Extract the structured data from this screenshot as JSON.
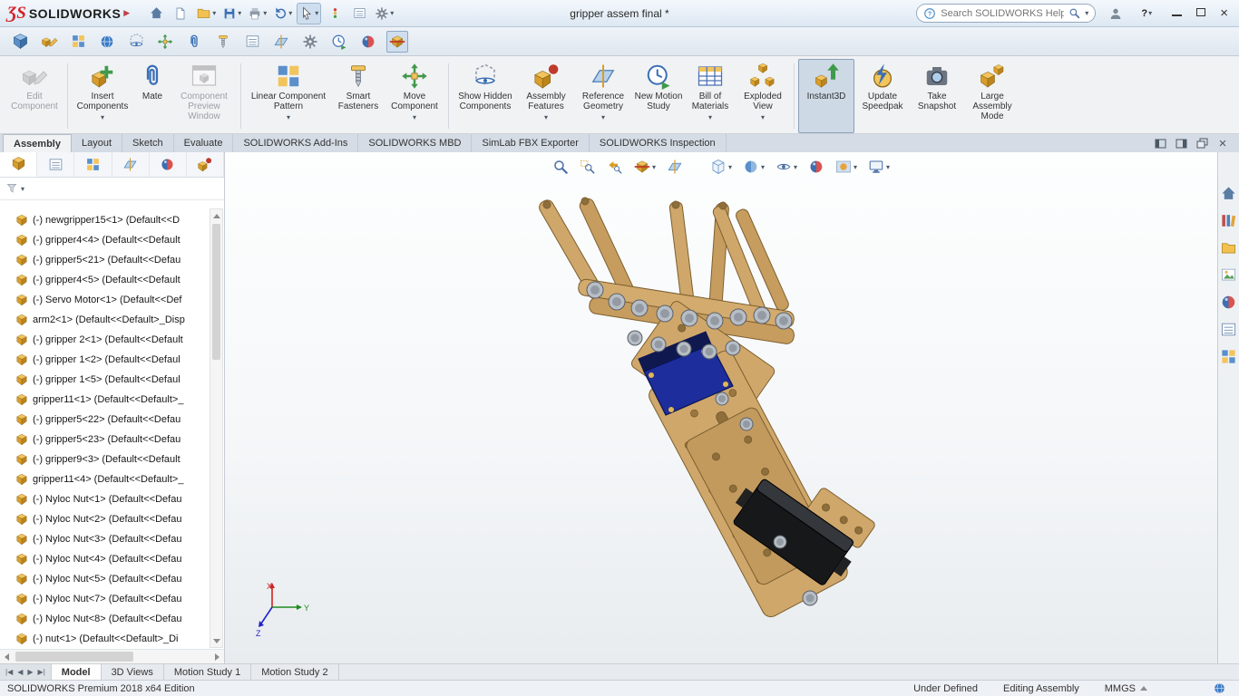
{
  "colors": {
    "brand_red": "#d42027",
    "accent_blue": "#3a6fb5",
    "part_tan": "#cfa76b",
    "servo_blue": "#1d2d9c",
    "active_highlight": "#cdd9e5"
  },
  "titlebar": {
    "brand_mark": "ƷS",
    "brand": "SOLIDWORKS",
    "menu_arrow": "▶",
    "doc_title": "gripper assem final *",
    "search_placeholder": "Search SOLIDWORKS Help",
    "help_label": "?",
    "icon_names": [
      "home-icon",
      "new-document-icon",
      "open-icon",
      "save-icon",
      "print-icon",
      "undo-icon",
      "select-cursor-icon",
      "stoplight-icon",
      "properties-list-icon",
      "options-gear-icon",
      "search-icon",
      "user-account-icon",
      "help-icon",
      "minimize-icon",
      "maximize-icon",
      "close-icon"
    ]
  },
  "quickbar": {
    "icon_names": [
      "view-cube-icon",
      "edit-part-icon",
      "pattern-grid-icon",
      "world-globe-icon",
      "hidden-component-icon",
      "move-component-icon",
      "mate-clip-icon",
      "fastener-screw-icon",
      "properties-list-icon",
      "reference-plane-icon",
      "options-gear-icon",
      "motion-clock-icon",
      "appearance-ball-icon",
      "section-view-icon"
    ]
  },
  "ribbon": {
    "buttons": [
      {
        "label": "Edit Component",
        "disabled": true,
        "dropdown": false
      },
      {
        "label": "Insert Components",
        "dropdown": true
      },
      {
        "label": "Mate",
        "dropdown": false
      },
      {
        "label": "Component Preview Window",
        "disabled": true,
        "dropdown": false
      },
      {
        "label": "Linear Component Pattern",
        "dropdown": true
      },
      {
        "label": "Smart Fasteners",
        "dropdown": false
      },
      {
        "label": "Move Component",
        "dropdown": true
      },
      {
        "label": "Show Hidden Components",
        "dropdown": false
      },
      {
        "label": "Assembly Features",
        "dropdown": true
      },
      {
        "label": "Reference Geometry",
        "dropdown": true
      },
      {
        "label": "New Motion Study",
        "dropdown": false
      },
      {
        "label": "Bill of Materials",
        "dropdown": true
      },
      {
        "label": "Exploded View",
        "dropdown": true
      },
      {
        "label": "Instant3D",
        "active": true,
        "dropdown": false
      },
      {
        "label": "Update Speedpak",
        "dropdown": false
      },
      {
        "label": "Take Snapshot",
        "dropdown": false
      },
      {
        "label": "Large Assembly Mode",
        "dropdown": false
      }
    ]
  },
  "command_tabs": [
    {
      "label": "Assembly",
      "active": true
    },
    {
      "label": "Layout"
    },
    {
      "label": "Sketch"
    },
    {
      "label": "Evaluate"
    },
    {
      "label": "SOLIDWORKS Add-Ins"
    },
    {
      "label": "SOLIDWORKS MBD"
    },
    {
      "label": "SimLab FBX Exporter"
    },
    {
      "label": "SOLIDWORKS Inspection"
    }
  ],
  "tree": {
    "items": [
      "(-) newgripper15<1> (Default<<D",
      "(-) gripper4<4> (Default<<Default",
      "(-) gripper5<21> (Default<<Defau",
      "(-) gripper4<5> (Default<<Default",
      "(-) Servo Motor<1> (Default<<Def",
      "arm2<1> (Default<<Default>_Disp",
      "(-) gripper 2<1> (Default<<Default",
      "(-) gripper 1<2> (Default<<Defaul",
      "(-) gripper 1<5> (Default<<Defaul",
      "gripper11<1> (Default<<Default>_",
      "(-) gripper5<22> (Default<<Defau",
      "(-) gripper5<23> (Default<<Defau",
      "(-) gripper9<3> (Default<<Default",
      "gripper11<4> (Default<<Default>_",
      "(-) Nyloc Nut<1> (Default<<Defau",
      "(-) Nyloc Nut<2> (Default<<Defau",
      "(-) Nyloc Nut<3> (Default<<Defau",
      "(-) Nyloc Nut<4> (Default<<Defau",
      "(-) Nyloc Nut<5> (Default<<Defau",
      "(-) Nyloc Nut<7> (Default<<Defau",
      "(-) Nyloc Nut<8> (Default<<Defau",
      "(-) nut<1> (Default<<Default>_Di"
    ]
  },
  "hud": {
    "icon_names": [
      "zoom-fit-icon",
      "zoom-area-icon",
      "previous-view-icon",
      "section-view-icon",
      "annotation-plane-icon",
      "view-orientation-icon",
      "display-style-icon",
      "hide-show-items-icon",
      "edit-appearance-icon",
      "apply-scene-icon",
      "view-settings-icon"
    ]
  },
  "taskpane": {
    "icon_names": [
      "solidworks-resources-icon",
      "design-library-icon",
      "file-explorer-icon",
      "view-palette-icon",
      "appearances-icon",
      "custom-properties-icon",
      "document-manager-icon"
    ]
  },
  "bottom_tabs": [
    {
      "label": "Model",
      "active": true
    },
    {
      "label": "3D Views"
    },
    {
      "label": "Motion Study 1"
    },
    {
      "label": "Motion Study 2"
    }
  ],
  "statusbar": {
    "edition": "SOLIDWORKS Premium 2018 x64 Edition",
    "constraint_state": "Under Defined",
    "mode": "Editing Assembly",
    "units": "MMGS"
  }
}
